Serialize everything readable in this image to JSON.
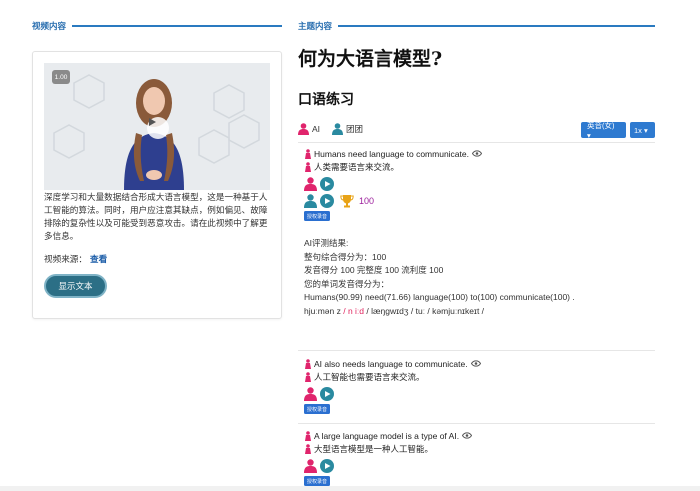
{
  "left_section_label": "视频内容",
  "right_section_label": "主题内容",
  "video": {
    "speed_badge": "1.00",
    "description": "深度学习和大量数据结合形成大语言模型，这是一种基于人工智能的算法。同时，用户应注意其缺点，例如偏见、故障排除的复杂性以及可能受到恶意攻击。请在此视频中了解更多信息。",
    "source_label": "视频来源：",
    "source_link": "查看",
    "show_text_button": "显示文本"
  },
  "title": "何为大语言模型?",
  "subtitle": "口语练习",
  "roles": {
    "ai": "AI",
    "team": "团团"
  },
  "controls": {
    "voice": "英音(女) ▾",
    "speed": "1x ▾"
  },
  "sentences": [
    {
      "en": "Humans need language to communicate.",
      "zh": "人类需要语言来交流。",
      "record": "授权录音",
      "score": "100"
    },
    {
      "en": "AI also needs language to communicate.",
      "zh": "人工智能也需要语言来交流。",
      "record": "授权录音"
    },
    {
      "en": "A large language model is a type of AI.",
      "zh": "大型语言模型是一种人工智能。",
      "record": "授权录音"
    }
  ],
  "result": {
    "heading": "AI评测结果:",
    "overall": "整句综合得分为：100",
    "detail": "发音得分 100 完整度 100 流利度 100",
    "word_heading": "您的单词发音得分为：",
    "words": "Humans(90.99) need(71.66) language(100) to(100) communicate(100) .",
    "phonetic_a": "hjuːmən z",
    "phonetic_sep1": " / ",
    "phonetic_b": "n iːd",
    "phonetic_rest": " / læŋɡwɪdʒ / tuː / kəmjuːnɪkeɪt /"
  },
  "colors": {
    "accent": "#2a7ac0",
    "female": "#e0246c",
    "male": "#2a8aa0",
    "score": "#9c1f9c"
  }
}
